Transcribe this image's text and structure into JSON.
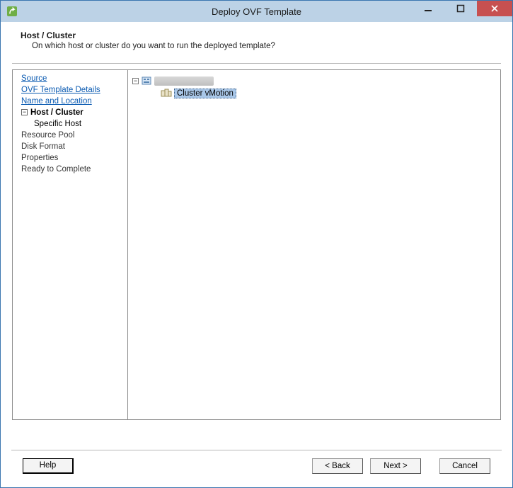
{
  "window": {
    "title": "Deploy OVF Template"
  },
  "header": {
    "title": "Host / Cluster",
    "subtitle": "On which host or cluster do you want to run the deployed template?"
  },
  "sidebar": {
    "items": [
      {
        "label": "Source",
        "kind": "link"
      },
      {
        "label": "OVF Template Details",
        "kind": "link"
      },
      {
        "label": "Name and Location",
        "kind": "link"
      },
      {
        "label": "Host / Cluster",
        "kind": "current",
        "toggle": "−"
      },
      {
        "label": "Specific Host",
        "kind": "sub"
      },
      {
        "label": "Resource Pool",
        "kind": "future"
      },
      {
        "label": "Disk Format",
        "kind": "future"
      },
      {
        "label": "Properties",
        "kind": "future"
      },
      {
        "label": "Ready to Complete",
        "kind": "future"
      }
    ]
  },
  "tree": {
    "root_toggle": "−",
    "root_label_redacted": true,
    "child_label": "Cluster vMotion"
  },
  "footer": {
    "help": "Help",
    "back": "< Back",
    "next": "Next >",
    "cancel": "Cancel"
  }
}
